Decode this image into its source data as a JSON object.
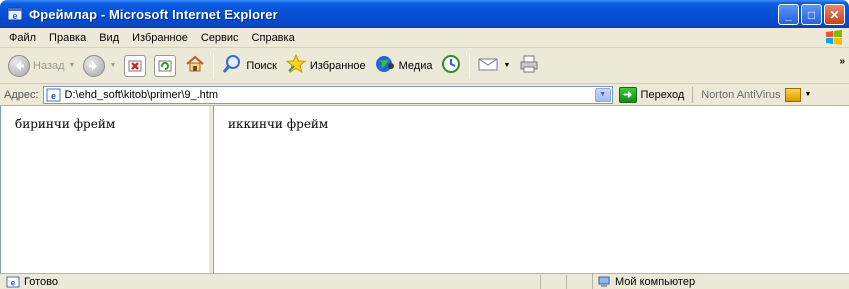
{
  "window": {
    "title": "Фреймлар - Microsoft Internet Explorer",
    "buttons": {
      "minimize": "_",
      "maximize": "□",
      "close": "✕"
    }
  },
  "menubar": {
    "items": [
      "Файл",
      "Правка",
      "Вид",
      "Избранное",
      "Сервис",
      "Справка"
    ]
  },
  "toolbar": {
    "back_label": "Назад",
    "search_label": "Поиск",
    "favorites_label": "Избранное",
    "media_label": "Медиа",
    "overflow": "»"
  },
  "addressbar": {
    "label": "Адрес:",
    "value": "D:\\ehd_soft\\kitob\\primer\\9_.htm",
    "go_label": "Переход",
    "norton_label": "Norton AntiVirus"
  },
  "frames": {
    "left_text": "биринчи фрейм",
    "right_text": "иккинчи фрейм"
  },
  "statusbar": {
    "status_text": "Готово",
    "zone_text": "Мой компьютер"
  },
  "colors": {
    "titlebar": "#0550d8",
    "chrome": "#ece9d8",
    "close_button": "#c6421d",
    "go_button": "#168c16"
  }
}
